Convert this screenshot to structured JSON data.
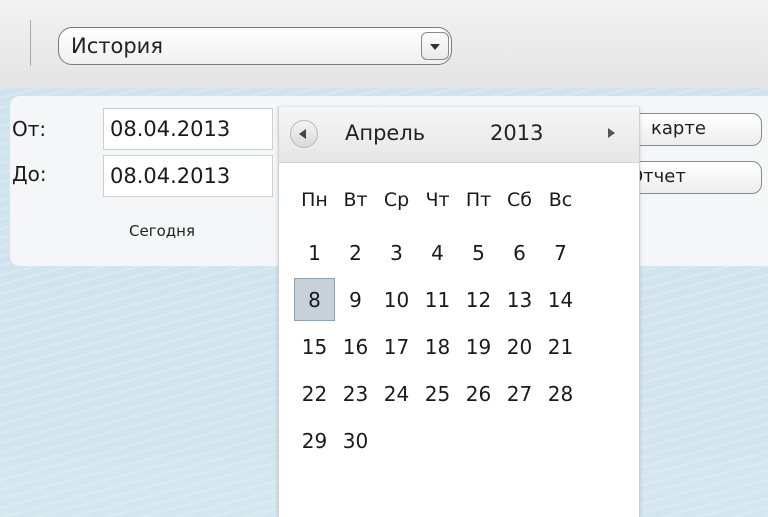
{
  "toolbar": {
    "history_select_value": "История"
  },
  "filter": {
    "from_label": "От:",
    "from_value": "08.04.2013",
    "to_label": "До:",
    "to_value": "08.04.2013",
    "today_label": "Сегодня",
    "map_button_label": "карте",
    "report_button_label": "Отчет"
  },
  "calendar": {
    "month": "Апрель",
    "year": "2013",
    "weekdays": [
      "Пн",
      "Вт",
      "Ср",
      "Чт",
      "Пт",
      "Сб",
      "Вс"
    ],
    "days": [
      "1",
      "2",
      "3",
      "4",
      "5",
      "6",
      "7",
      "8",
      "9",
      "10",
      "11",
      "12",
      "13",
      "14",
      "15",
      "16",
      "17",
      "18",
      "19",
      "20",
      "21",
      "22",
      "23",
      "24",
      "25",
      "26",
      "27",
      "28",
      "29",
      "30"
    ],
    "selected_day": "8"
  },
  "colors": {
    "selected_day_bg": "#c6d1da",
    "background": "#d8e6ef"
  }
}
